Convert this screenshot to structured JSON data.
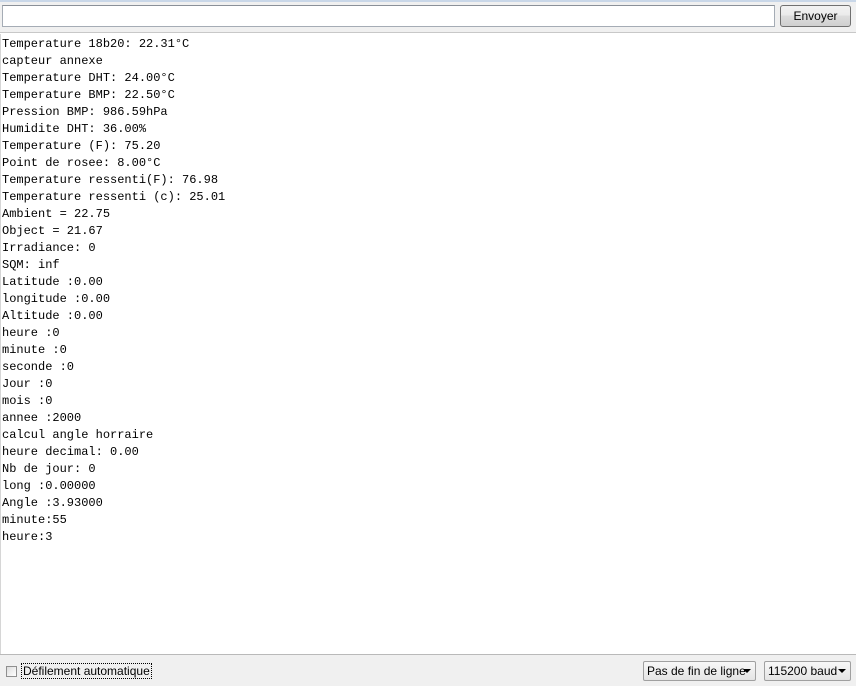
{
  "send_bar": {
    "input_value": "",
    "send_label": "Envoyer"
  },
  "output": {
    "lines": [
      "Temperature 18b20: 22.31°C",
      "capteur annexe",
      "Temperature DHT: 24.00°C",
      "Temperature BMP: 22.50°C",
      "Pression BMP: 986.59hPa",
      "Humidite DHT: 36.00%",
      "Temperature (F): 75.20",
      "Point de rosee: 8.00°C",
      "Temperature ressenti(F): 76.98",
      "Temperature ressenti (c): 25.01",
      "Ambient = 22.75",
      "Object = 21.67",
      "Irradiance: 0",
      "SQM: inf",
      "Latitude :0.00",
      "longitude :0.00",
      "Altitude :0.00",
      "heure :0",
      "minute :0",
      "seconde :0",
      "Jour :0",
      "mois :0",
      "annee :2000",
      "calcul angle horraire",
      "heure decimal: 0.00",
      "Nb de jour: 0",
      "long :0.00000",
      "Angle :3.93000",
      "minute:55",
      "heure:3"
    ]
  },
  "bottom_bar": {
    "autoscroll_label": "Défilement automatique",
    "autoscroll_checked": false,
    "line_ending": "Pas de fin de ligne",
    "baud_rate": "115200 baud"
  }
}
